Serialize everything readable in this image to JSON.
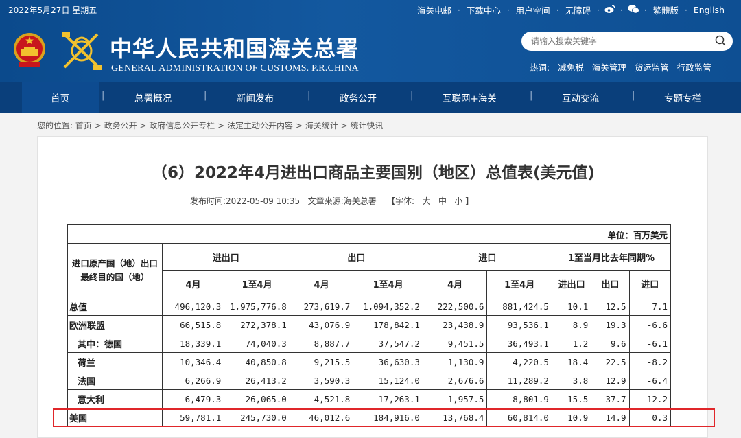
{
  "topbar": {
    "date": "2022年5月27日 星期五",
    "links": [
      "海关电邮",
      "下载中心",
      "用户空间",
      "无障碍",
      "繁體版",
      "English"
    ]
  },
  "header": {
    "site_title": "中华人民共和国海关总署",
    "site_subtitle": "GENERAL ADMINISTRATION OF CUSTOMS. P.R.CHINA",
    "search_placeholder": "请输入搜索关键字",
    "hot_label": "热词:",
    "hot_words": [
      "减免税",
      "海关管理",
      "货运监管",
      "行政监管"
    ]
  },
  "nav": {
    "items": [
      "首页",
      "总署概况",
      "新闻发布",
      "政务公开",
      "互联网+海关",
      "互动交流",
      "专题专栏"
    ],
    "active": "首页"
  },
  "breadcrumb": {
    "label": "您的位置:",
    "items": [
      "首页",
      "政务公开",
      "政府信息公开专栏",
      "法定主动公开内容",
      "海关统计",
      "统计快讯"
    ]
  },
  "article": {
    "title": "（6）2022年4月进出口商品主要国别（地区）总值表(美元值)",
    "publish_label": "发布时间:",
    "publish_time": "2022-05-09 10:35",
    "source_label": "文章来源:",
    "source": "海关总署",
    "font_label": "【字体:",
    "font_sizes": [
      "大",
      "中",
      "小"
    ],
    "font_close": "】"
  },
  "table": {
    "unit": "单位：百万美元",
    "corner_header": "进口原产国（地）出口最终目的国（地）",
    "group_headers": [
      "进出口",
      "出口",
      "进口",
      "1至当月比去年同期%"
    ],
    "sub_headers": [
      "4月",
      "1至4月",
      "4月",
      "1至4月",
      "4月",
      "1至4月",
      "进出口",
      "出口",
      "进口"
    ],
    "rows": [
      {
        "name": "总值",
        "indent": false,
        "values": [
          "496,120.3",
          "1,975,776.8",
          "273,619.7",
          "1,094,352.2",
          "222,500.6",
          "881,424.5",
          "10.1",
          "12.5",
          "7.1"
        ]
      },
      {
        "name": "欧洲联盟",
        "indent": false,
        "values": [
          "66,515.8",
          "272,378.1",
          "43,076.9",
          "178,842.1",
          "23,438.9",
          "93,536.1",
          "8.9",
          "19.3",
          "-6.6"
        ]
      },
      {
        "name": "其中：德国",
        "indent": true,
        "values": [
          "18,339.1",
          "74,040.3",
          "8,887.7",
          "37,547.2",
          "9,451.5",
          "36,493.1",
          "1.2",
          "9.6",
          "-6.1"
        ]
      },
      {
        "name": "荷兰",
        "indent": true,
        "values": [
          "10,346.4",
          "40,850.8",
          "9,215.5",
          "36,630.3",
          "1,130.9",
          "4,220.5",
          "18.4",
          "22.5",
          "-8.2"
        ]
      },
      {
        "name": "法国",
        "indent": true,
        "values": [
          "6,266.9",
          "26,413.2",
          "3,590.3",
          "15,124.0",
          "2,676.6",
          "11,289.2",
          "3.8",
          "12.9",
          "-6.4"
        ]
      },
      {
        "name": "意大利",
        "indent": true,
        "values": [
          "6,479.3",
          "26,065.0",
          "4,521.8",
          "17,263.1",
          "1,957.5",
          "8,801.9",
          "15.5",
          "37.7",
          "-12.2"
        ]
      },
      {
        "name": "美国",
        "indent": false,
        "values": [
          "59,781.1",
          "245,730.0",
          "46,012.6",
          "184,916.0",
          "13,768.4",
          "60,814.0",
          "10.9",
          "14.9",
          "0.3"
        ]
      }
    ]
  },
  "colors": {
    "header_blue": "#0f4d92",
    "nav_blue": "#0a3f7b",
    "highlight_red": "#e0262a"
  }
}
